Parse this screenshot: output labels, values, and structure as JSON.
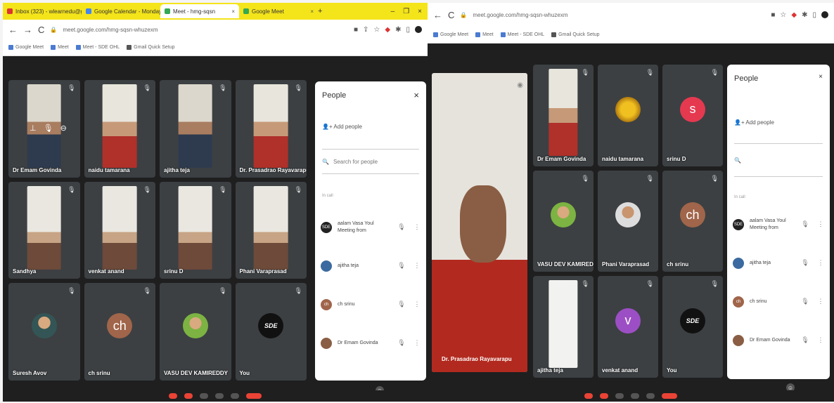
{
  "left": {
    "tabs": [
      {
        "label": "Inbox (323) - wlearnedu@gmai",
        "active": false
      },
      {
        "label": "Google Calendar - Monday, N",
        "active": false
      },
      {
        "label": "Meet - hmg-sqsn",
        "active": true
      },
      {
        "label": "Google Meet",
        "active": false
      }
    ],
    "url": "meet.google.com/hmg-sqsn-whuzexm",
    "bookmarks": [
      "Google Meet",
      "Meet",
      "Meet - SDE OHL",
      "Gmail Quick Setup"
    ],
    "tiles": [
      {
        "name": "Dr Emam Govinda"
      },
      {
        "name": "naidu tamarana"
      },
      {
        "name": "ajitha teja"
      },
      {
        "name": "Dr. Prasadrao Rayavarapu"
      },
      {
        "name": "Sandhya"
      },
      {
        "name": "venkat anand"
      },
      {
        "name": "srinu D"
      },
      {
        "name": "Phani Varaprasad"
      },
      {
        "name": "Suresh Avov"
      },
      {
        "name": "ch srinu",
        "avatar": "ch"
      },
      {
        "name": "VASU DEV KAMIREDDY"
      },
      {
        "name": "You",
        "avatar": "SDE"
      }
    ],
    "people": {
      "title": "People",
      "add": "Add people",
      "search_placeholder": "Search for people",
      "caption": "In call",
      "rows": [
        {
          "name": "aalam Vasa Youl Meeting from",
          "avatar": "SDE"
        },
        {
          "name": "ajitha teja",
          "avatar": ""
        },
        {
          "name": "ch srinu",
          "avatar": "ch"
        },
        {
          "name": "Dr Emam Govinda",
          "avatar": ""
        }
      ]
    },
    "tile_icons": {
      "pin": "pin-icon",
      "mute": "mute-icon",
      "remove": "remove-icon"
    }
  },
  "right": {
    "url": "meet.google.com/hmg-sqsn-whuzexm",
    "bookmarks": [
      "Google Meet",
      "Meet",
      "Meet - SDE OHL",
      "Gmail Quick Setup"
    ],
    "featured_name": "Dr. Prasadrao Rayavarapu",
    "tiles": [
      {
        "name": "Dr Emam Govinda"
      },
      {
        "name": "naidu tamarana"
      },
      {
        "name": "srinu D",
        "avatar": "s"
      },
      {
        "name": "VASU DEV KAMIREDDY"
      },
      {
        "name": "Phani Varaprasad"
      },
      {
        "name": "ch srinu",
        "avatar": "ch"
      },
      {
        "name": "ajitha teja"
      },
      {
        "name": "venkat anand",
        "avatar": "v"
      },
      {
        "name": "You",
        "avatar": "SDE"
      }
    ],
    "people": {
      "title": "People",
      "add": "Add people",
      "caption": "In call",
      "rows": [
        {
          "name": "aalam Vasa Youl Meeting from",
          "avatar": "SDE"
        },
        {
          "name": "ajitha teja",
          "avatar": ""
        },
        {
          "name": "ch srinu",
          "avatar": "ch"
        },
        {
          "name": "Dr Emam Govinda",
          "avatar": ""
        }
      ]
    }
  },
  "colors": {
    "meet_bg": "#1f1f20",
    "tile": "#3c4043",
    "tabbar": "#f4e41a",
    "avatar_s": "#e53950",
    "avatar_ch": "#a0654a",
    "avatar_v": "#9c4fc4"
  }
}
